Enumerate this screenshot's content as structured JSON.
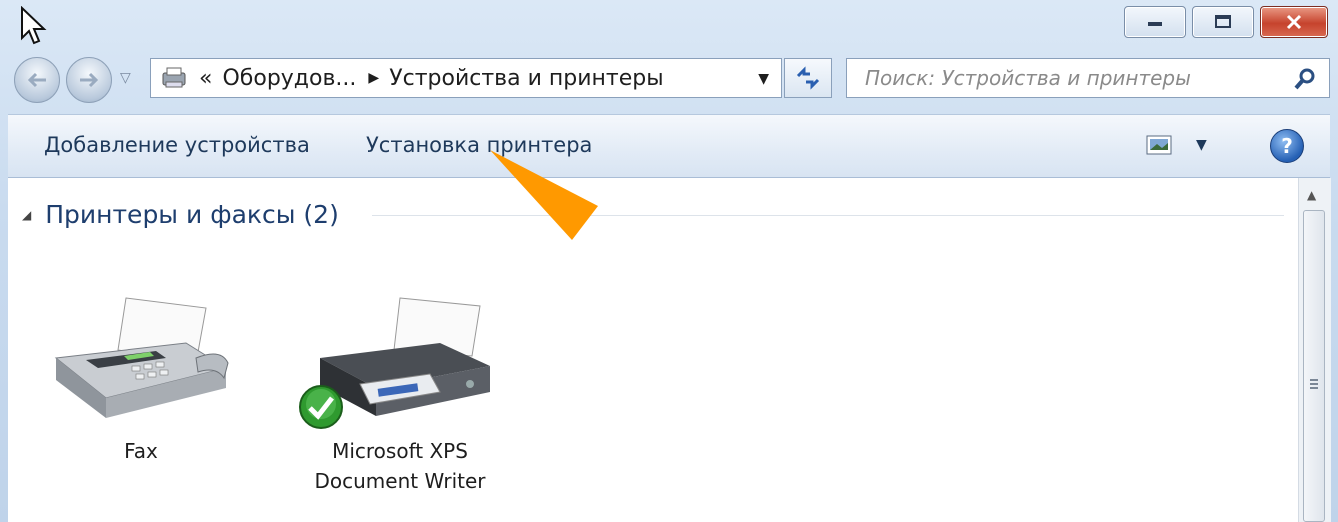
{
  "window": {
    "buttons": {
      "minimize": "minimize",
      "maximize": "maximize",
      "close": "close"
    }
  },
  "nav": {
    "address_prefix": "«",
    "address_parent": "Оборудов...",
    "address_separator": "▶",
    "address_current": "Устройства и принтеры",
    "address_dropdown": "▼",
    "search_placeholder": "Поиск: Устройства и принтеры"
  },
  "toolbar": {
    "add_device": "Добавление устройства",
    "add_printer": "Установка принтера",
    "view_dropdown": "▼",
    "help": "?"
  },
  "group": {
    "toggle": "◢",
    "title": "Принтеры и факсы (2)"
  },
  "devices": [
    {
      "label_line1": "Fax",
      "label_line2": "",
      "icon": "fax-icon",
      "default": false
    },
    {
      "label_line1": "Microsoft XPS",
      "label_line2": "Document Writer",
      "icon": "printer-icon",
      "default": true
    }
  ],
  "annotation": {
    "arrow_color": "#ff9900",
    "points_to": "Установка принтера"
  },
  "colors": {
    "accent": "#1e3e6e",
    "close_red": "#c6432d",
    "check_green": "#2f9a2f"
  }
}
